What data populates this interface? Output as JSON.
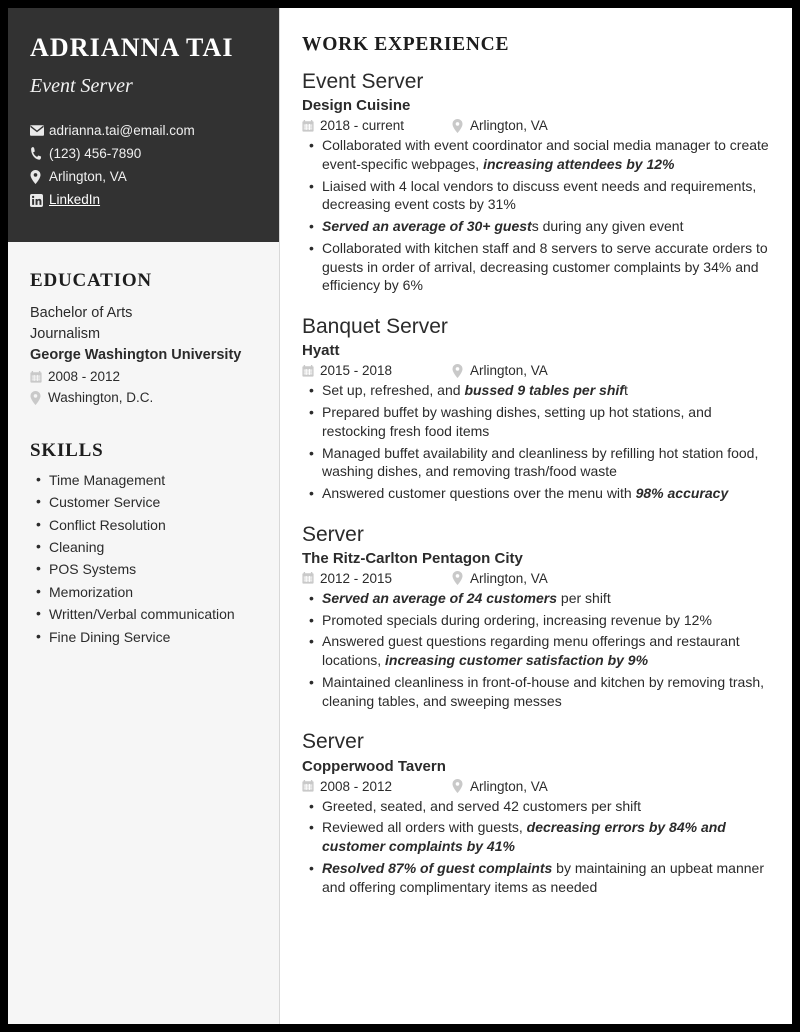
{
  "document": {
    "kind": "resume",
    "accent_dark": "#323232",
    "sidebar_bg": "#f6f6f6",
    "page_bg": "#ffffff",
    "text_color": "#2b2b2b"
  },
  "sidebar": {
    "identity": {
      "name": "ADRIANNA TAI",
      "title": "Event Server"
    },
    "contacts": [
      {
        "icon": "envelope-icon",
        "label": "adrianna.tai@email.com",
        "link": false
      },
      {
        "icon": "phone-icon",
        "label": "(123) 456-7890",
        "link": false
      },
      {
        "icon": "map-pin-icon",
        "label": "Arlington, VA",
        "link": false
      },
      {
        "icon": "linkedin-icon",
        "label": "LinkedIn",
        "link": true
      }
    ],
    "education": {
      "heading": "EDUCATION",
      "degree": "Bachelor of Arts",
      "field": "Journalism",
      "school": "George Washington University",
      "dates": "2008 - 2012",
      "location": "Washington, D.C."
    },
    "skills": {
      "heading": "SKILLS",
      "items": [
        "Time Management",
        "Customer Service",
        "Conflict Resolution",
        "Cleaning",
        "POS Systems",
        "Memorization",
        "Written/Verbal communication",
        "Fine Dining Service"
      ]
    }
  },
  "main": {
    "heading": "WORK EXPERIENCE",
    "jobs": [
      {
        "title": "Event Server",
        "company": "Design Cuisine",
        "dates": "2018 - current",
        "location": "Arlington, VA",
        "bullets": [
          [
            {
              "t": "Collaborated with event coordinator and social media manager to create event-specific webpages, ",
              "em": false
            },
            {
              "t": "increasing attendees by 12%",
              "em": true
            }
          ],
          [
            {
              "t": "Liaised with 4 local vendors to discuss event needs and requirements, decreasing event costs by 31%",
              "em": false
            }
          ],
          [
            {
              "t": "Served an average of 30+ guest",
              "em": true
            },
            {
              "t": "s during any given event",
              "em": false
            }
          ],
          [
            {
              "t": "Collaborated with kitchen staff and 8 servers to serve accurate orders to guests in order of arrival, decreasing customer complaints by 34% and efficiency by 6%",
              "em": false
            }
          ]
        ]
      },
      {
        "title": "Banquet Server",
        "company": "Hyatt",
        "dates": "2015 - 2018",
        "location": "Arlington, VA",
        "bullets": [
          [
            {
              "t": "Set up, refreshed, and ",
              "em": false
            },
            {
              "t": "bussed 9 tables per shif",
              "em": true
            },
            {
              "t": "t",
              "em": false
            }
          ],
          [
            {
              "t": "Prepared buffet by washing dishes, setting up hot stations, and restocking fresh food items",
              "em": false
            }
          ],
          [
            {
              "t": "Managed buffet availability and cleanliness by refilling hot station food, washing dishes, and removing trash/food waste",
              "em": false
            }
          ],
          [
            {
              "t": "Answered customer questions over the menu with ",
              "em": false
            },
            {
              "t": "98% accuracy",
              "em": true
            }
          ]
        ]
      },
      {
        "title": "Server",
        "company": "The Ritz-Carlton Pentagon City",
        "dates": "2012 - 2015",
        "location": "Arlington, VA",
        "bullets": [
          [
            {
              "t": "Served an average of 24 customers",
              "em": true
            },
            {
              "t": " per shift",
              "em": false
            }
          ],
          [
            {
              "t": "Promoted specials during ordering, increasing revenue by 12%",
              "em": false
            }
          ],
          [
            {
              "t": "Answered guest questions regarding menu offerings and restaurant locations, ",
              "em": false
            },
            {
              "t": "increasing customer satisfaction by 9%",
              "em": true
            }
          ],
          [
            {
              "t": "Maintained cleanliness in front-of-house and kitchen by removing trash, cleaning tables, and sweeping messes",
              "em": false
            }
          ]
        ]
      },
      {
        "title": "Server",
        "company": "Copperwood Tavern",
        "dates": "2008 - 2012",
        "location": "Arlington, VA",
        "bullets": [
          [
            {
              "t": "Greeted, seated, and served 42 customers per shift",
              "em": false
            }
          ],
          [
            {
              "t": "Reviewed all orders with guests, ",
              "em": false
            },
            {
              "t": "decreasing errors by 84% and customer complaints by 41%",
              "em": true
            }
          ],
          [
            {
              "t": "Resolved 87% of guest complaints",
              "em": true
            },
            {
              "t": " by maintaining an upbeat manner and offering complimentary items as needed",
              "em": false
            }
          ]
        ]
      }
    ]
  }
}
